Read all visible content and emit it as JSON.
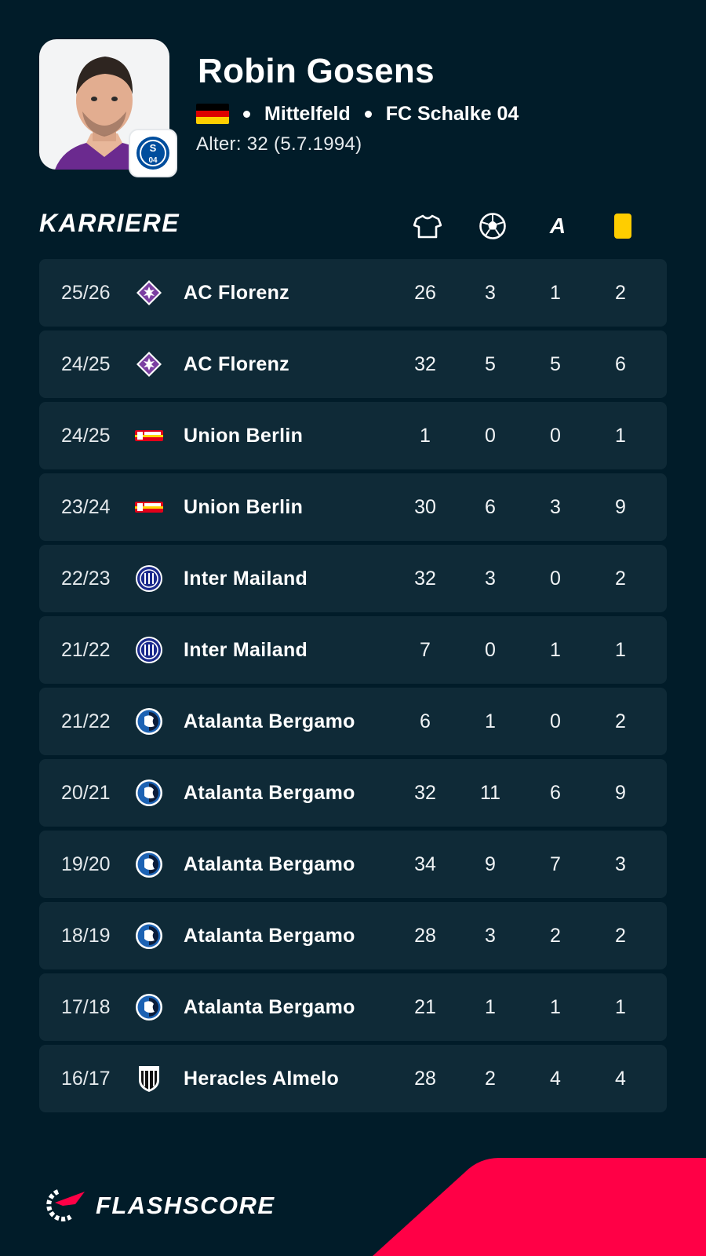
{
  "player": {
    "name": "Robin Gosens",
    "position": "Mittelfeld",
    "club": "FC Schalke 04",
    "age_line": "Alter: 32  (5.7.1994)",
    "flag_colors": [
      "#000000",
      "#dd0000",
      "#ffce00"
    ]
  },
  "career": {
    "title": "KARRIERE",
    "columns": [
      {
        "icon": "jersey-icon"
      },
      {
        "icon": "ball-icon"
      },
      {
        "icon": "assists-icon",
        "label": "A"
      },
      {
        "icon": "yellow-card-icon",
        "color": "#ffcd00"
      }
    ],
    "rows": [
      {
        "season": "25/26",
        "team": "AC Florenz",
        "logo": "fiorentina-icon",
        "apps": "26",
        "goals": "3",
        "assists": "1",
        "yellow": "2"
      },
      {
        "season": "24/25",
        "team": "AC Florenz",
        "logo": "fiorentina-icon",
        "apps": "32",
        "goals": "5",
        "assists": "5",
        "yellow": "6"
      },
      {
        "season": "24/25",
        "team": "Union Berlin",
        "logo": "union-berlin-icon",
        "apps": "1",
        "goals": "0",
        "assists": "0",
        "yellow": "1"
      },
      {
        "season": "23/24",
        "team": "Union Berlin",
        "logo": "union-berlin-icon",
        "apps": "30",
        "goals": "6",
        "assists": "3",
        "yellow": "9"
      },
      {
        "season": "22/23",
        "team": "Inter Mailand",
        "logo": "inter-icon",
        "apps": "32",
        "goals": "3",
        "assists": "0",
        "yellow": "2"
      },
      {
        "season": "21/22",
        "team": "Inter Mailand",
        "logo": "inter-icon",
        "apps": "7",
        "goals": "0",
        "assists": "1",
        "yellow": "1"
      },
      {
        "season": "21/22",
        "team": "Atalanta Bergamo",
        "logo": "atalanta-icon",
        "apps": "6",
        "goals": "1",
        "assists": "0",
        "yellow": "2"
      },
      {
        "season": "20/21",
        "team": "Atalanta Bergamo",
        "logo": "atalanta-icon",
        "apps": "32",
        "goals": "11",
        "assists": "6",
        "yellow": "9"
      },
      {
        "season": "19/20",
        "team": "Atalanta Bergamo",
        "logo": "atalanta-icon",
        "apps": "34",
        "goals": "9",
        "assists": "7",
        "yellow": "3"
      },
      {
        "season": "18/19",
        "team": "Atalanta Bergamo",
        "logo": "atalanta-icon",
        "apps": "28",
        "goals": "3",
        "assists": "2",
        "yellow": "2"
      },
      {
        "season": "17/18",
        "team": "Atalanta Bergamo",
        "logo": "atalanta-icon",
        "apps": "21",
        "goals": "1",
        "assists": "1",
        "yellow": "1"
      },
      {
        "season": "16/17",
        "team": "Heracles Almelo",
        "logo": "heracles-icon",
        "apps": "28",
        "goals": "2",
        "assists": "4",
        "yellow": "4"
      }
    ]
  },
  "brand": {
    "name": "FLASHSCORE",
    "accent": "#ff0046"
  }
}
